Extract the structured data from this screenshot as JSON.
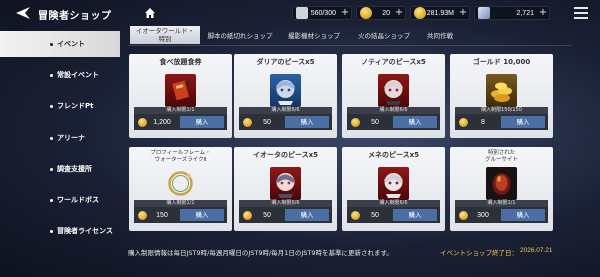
{
  "header": {
    "title": "冒険者ショップ",
    "back_icon": "back-arrow-icon",
    "home_icon": "home-icon",
    "resources": [
      {
        "icon": "stamina-icon",
        "value": "560/300"
      },
      {
        "icon": "gold-coin-icon",
        "value": "20"
      },
      {
        "icon": "gold-coin-icon",
        "value": "281.93M"
      },
      {
        "icon": "gem-icon",
        "value": "2,721"
      }
    ],
    "plus": "+",
    "menu_icon": "hamburger-menu-icon"
  },
  "sidebar": {
    "items": [
      {
        "label": "イベント",
        "active": true
      },
      {
        "label": "常設イベント",
        "active": false
      },
      {
        "label": "フレンドPt",
        "active": false
      },
      {
        "label": "アリーナ",
        "active": false
      },
      {
        "label": "調査支援所",
        "active": false
      },
      {
        "label": "ワールドボス",
        "active": false
      },
      {
        "label": "冒険者ライセンス",
        "active": false
      }
    ]
  },
  "tabs": [
    {
      "label": "イオータワールド・",
      "label2": "特別",
      "active": true
    },
    {
      "label": "脚本の紙切れショップ",
      "active": false
    },
    {
      "label": "撮影機材ショップ",
      "active": false
    },
    {
      "label": "火の結晶ショップ",
      "active": false
    },
    {
      "label": "共同作戦",
      "active": false
    }
  ],
  "items": [
    {
      "name": "食べ放題食券",
      "limit": "購入制限1/1",
      "price": "1,200",
      "buy": "購入",
      "icon": "food-ticket-icon"
    },
    {
      "name": "ダリアのピースx5",
      "limit": "購入制限6/6",
      "price": "50",
      "buy": "購入",
      "icon": "character-piece-icon"
    },
    {
      "name": "ノティアのピースx5",
      "limit": "購入制限6/6",
      "price": "50",
      "buy": "購入",
      "icon": "character-piece-icon"
    },
    {
      "name": "ゴールド 10,000",
      "limit": "購入制限150/150",
      "price": "8",
      "buy": "購入",
      "icon": "gold-pile-icon"
    },
    {
      "name": "プロフィールフレーム・",
      "name2": "ウォーターズライクⅡ",
      "limit": "購入制限1/1",
      "price": "150",
      "buy": "購入",
      "icon": "profile-frame-icon"
    },
    {
      "name": "イオータのピースx5",
      "limit": "購入制限6/6",
      "price": "50",
      "buy": "購入",
      "icon": "character-piece-icon"
    },
    {
      "name": "メネのピースx5",
      "limit": "購入制限6/6",
      "price": "50",
      "buy": "購入",
      "icon": "character-piece-icon"
    },
    {
      "name": "特別された",
      "name2": "グルーサイト",
      "limit": "購入制限1/1",
      "price": "300",
      "buy": "購入",
      "icon": "red-gem-icon"
    }
  ],
  "footer": {
    "note": "購入制限情報は毎日JST9時/毎週月曜日のJST9時/毎月1日のJST9時を基準に更新されます。",
    "end_label": "イベントショップ終了日：",
    "end_date": "2026.07.21"
  },
  "colors": {
    "accent": "#4b6ea5",
    "highlight": "#f2c84b"
  }
}
